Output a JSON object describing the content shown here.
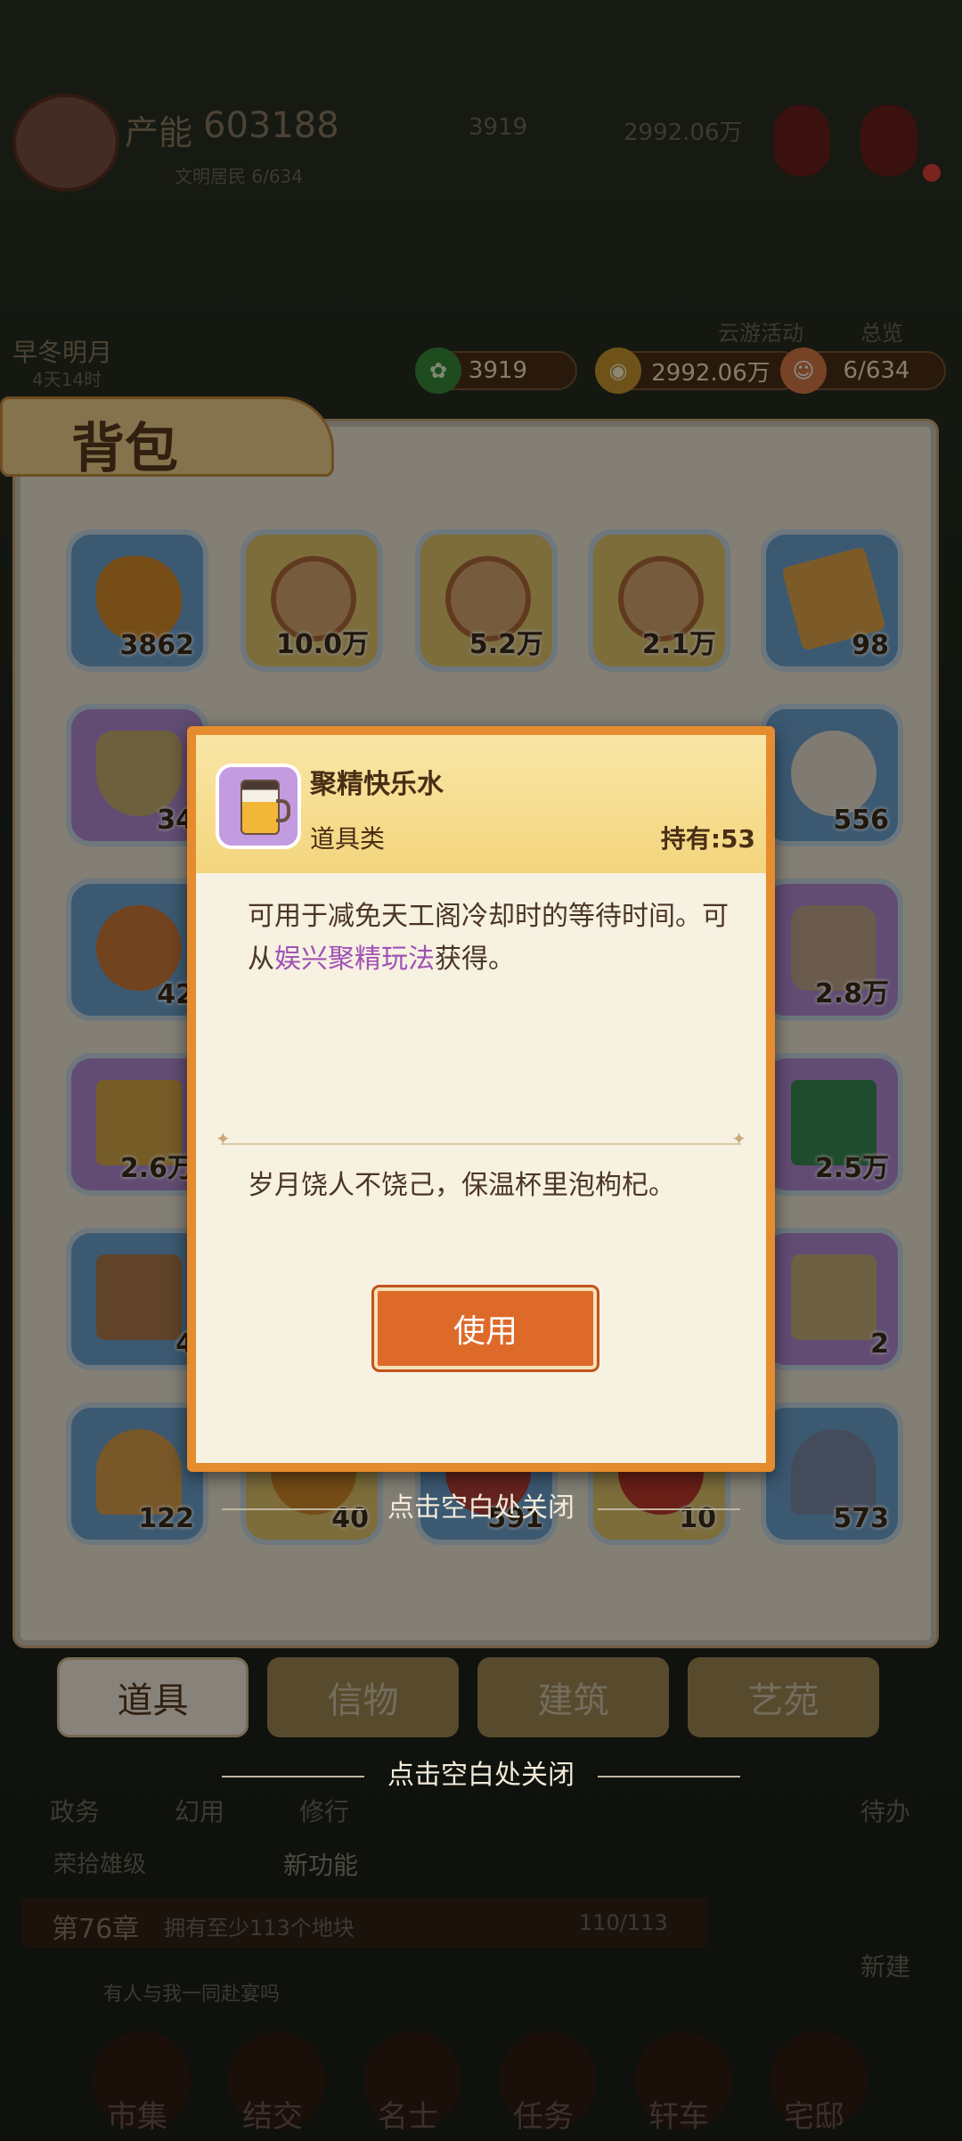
{
  "top_bar": {
    "power_label": "产能",
    "power_value": "603188",
    "resident_text": "文明居民 6/634",
    "currency_a": "3919",
    "currency_b": "2992.06万",
    "date_label": "早冬明月",
    "date_sub": "4天14时"
  },
  "events": {
    "cloud_event": "云游活动",
    "overview": "总览"
  },
  "bag_bar": {
    "jade": "3919",
    "coins": "2992.06万",
    "residents": "6/634"
  },
  "bag": {
    "title": "背包",
    "slot_counts": [
      "3862",
      "10.0万",
      "5.2万",
      "2.1万",
      "98",
      "34",
      "556",
      "42",
      "2.8万",
      "2.6万",
      "2.5万",
      "4",
      "2",
      "122",
      "40",
      "591",
      "10",
      "573"
    ],
    "tabs": [
      "道具",
      "信物",
      "建筑",
      "艺苑"
    ]
  },
  "modal": {
    "item_name": "聚精快乐水",
    "category": "道具类",
    "holding": "持有:53",
    "desc_part1": "可用于减免天工阁冷却时的等待时间。可从",
    "desc_link": "娱兴聚精玩法",
    "desc_part2": "获得。",
    "flavor": "岁月饶人不饶己，保温杯里泡枸杞。",
    "use_button": "使用"
  },
  "close_hint": "点击空白处关闭",
  "bottom_bg": {
    "side_items": [
      "政务",
      "幻用",
      "修行"
    ],
    "quest_tag": "荣拾雄级",
    "new_feature": "新功能",
    "chapter": "第76章",
    "chapter_task": "拥有至少113个地块",
    "chapter_progress": "110/113",
    "chat_text": "有人与我一同赴宴吗",
    "right_items": [
      "待办",
      "新建"
    ],
    "nav": [
      "市集",
      "结交",
      "名士",
      "任务",
      "轩车",
      "宅邸"
    ]
  },
  "colors": {
    "modal_border": "#e58c2e",
    "button": "#de6a2a",
    "highlight": "#a052b5"
  }
}
